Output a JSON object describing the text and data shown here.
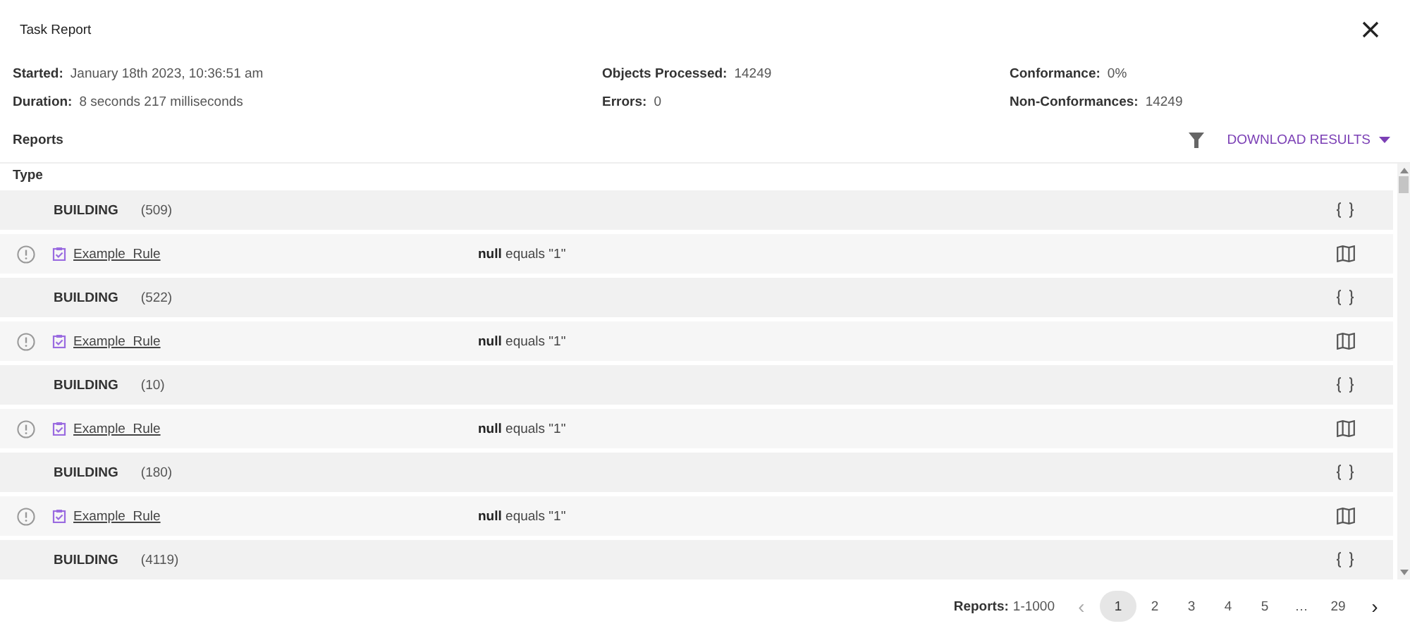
{
  "window": {
    "title": "Task Report"
  },
  "summary": [
    {
      "label": "Started:",
      "value": "January 18th 2023, 10:36:51 am"
    },
    {
      "label": "Objects Processed:",
      "value": "14249"
    },
    {
      "label": "Conformance:",
      "value": "0%"
    },
    {
      "label": "Duration:",
      "value": "8 seconds 217 milliseconds"
    },
    {
      "label": "Errors:",
      "value": "0"
    },
    {
      "label": "Non-Conformances:",
      "value": "14249"
    }
  ],
  "reports": {
    "heading": "Reports",
    "download": "DOWNLOAD RESULTS"
  },
  "table": {
    "columns": [
      "Type"
    ],
    "rows": [
      {
        "kind": "group",
        "type": "BUILDING",
        "count": "(509)"
      },
      {
        "kind": "rule",
        "rule": "Example_Rule",
        "condition": "**null** equals \"1\""
      },
      {
        "kind": "group",
        "type": "BUILDING",
        "count": "(522)"
      },
      {
        "kind": "rule",
        "rule": "Example_Rule",
        "condition": "**null** equals \"1\""
      },
      {
        "kind": "group",
        "type": "BUILDING",
        "count": "(10)"
      },
      {
        "kind": "rule",
        "rule": "Example_Rule",
        "condition": "**null** equals \"1\""
      },
      {
        "kind": "group",
        "type": "BUILDING",
        "count": "(180)"
      },
      {
        "kind": "rule",
        "rule": "Example_Rule",
        "condition": "**null** equals \"1\""
      },
      {
        "kind": "group",
        "type": "BUILDING",
        "count": "(4119)"
      }
    ]
  },
  "pagination": {
    "label": "Reports:",
    "range": "1-1000",
    "prev": "‹",
    "next": "›",
    "prev_disabled": true,
    "next_disabled": false,
    "pages": [
      {
        "label": "1",
        "selected": true
      },
      {
        "label": "2",
        "selected": false
      },
      {
        "label": "3",
        "selected": false
      },
      {
        "label": "4",
        "selected": false
      },
      {
        "label": "5",
        "selected": false
      },
      {
        "label": "…",
        "selected": false
      },
      {
        "label": "29",
        "selected": false
      }
    ]
  }
}
